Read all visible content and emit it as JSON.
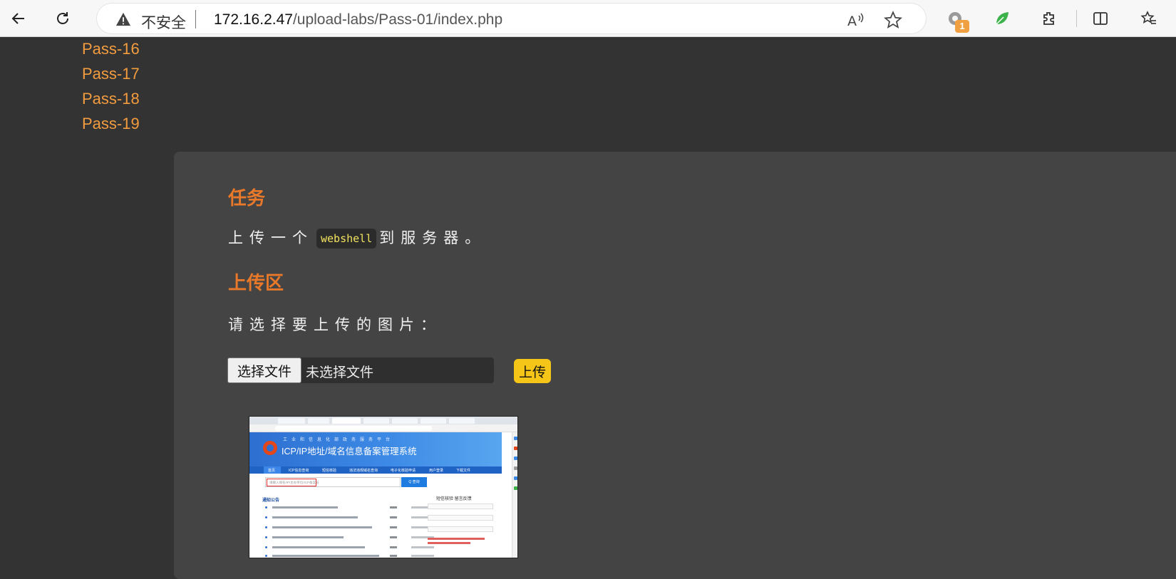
{
  "browser": {
    "security_label": "不安全",
    "url_host": "172.16.2.47",
    "url_path": "/upload-labs/Pass-01/index.php",
    "extension_badge": "1",
    "icons": [
      "back-icon",
      "reload-icon",
      "warning-icon",
      "read-aloud-icon",
      "favorite-star-icon",
      "extension-icon",
      "leaf-extension-icon",
      "puzzle-icon",
      "split-screen-icon",
      "favorites-icon"
    ]
  },
  "sidebar": {
    "links": [
      {
        "label": "Pass-16"
      },
      {
        "label": "Pass-17"
      },
      {
        "label": "Pass-18"
      },
      {
        "label": "Pass-19"
      }
    ]
  },
  "task": {
    "heading": "任务",
    "text_before": "上传一个",
    "code": "webshell",
    "text_after": "到服务器。"
  },
  "upload": {
    "heading": "上传区",
    "prompt": "请选择要上传的图片：",
    "choose_button": "选择文件",
    "no_file_text": "未选择文件",
    "submit_button": "上传"
  },
  "preview": {
    "banner_subtitle": "工业和信息化部政务服务平台",
    "banner_title": "ICP/IP地址/域名信息备案管理系统",
    "nav_items": [
      "首页",
      "ICP信息查询",
      "短信核验",
      "违法违规域名查询",
      "电子化核验申请",
      "用户登录",
      "下载文件"
    ],
    "search_placeholder": "请输入域名/IP/主办单位/ICP备案号",
    "search_button": "Q 查询",
    "section_title": "通知公告",
    "side_tabs": "短信核验    留言反馈"
  },
  "colors": {
    "page_bg": "#333333",
    "panel_bg": "#444444",
    "link": "#f39c3f",
    "heading": "#e8782a",
    "upload_button": "#f5c518"
  }
}
